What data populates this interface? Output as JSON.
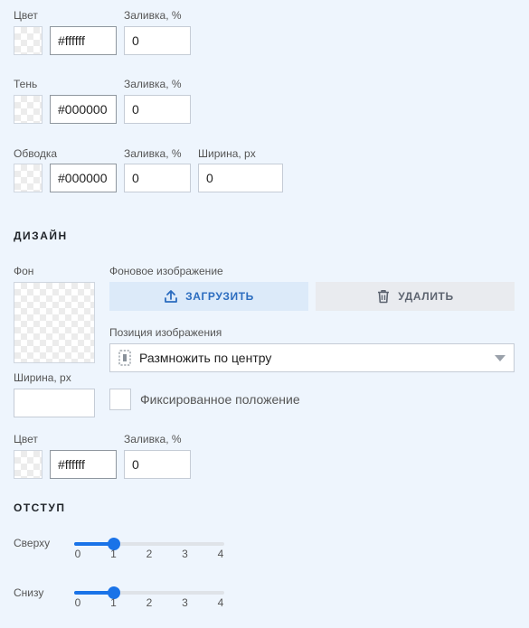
{
  "color_block": {
    "label": "Цвет",
    "fill_label": "Заливка, %",
    "hex": "#ffffff",
    "fill": "0"
  },
  "shadow_block": {
    "label": "Тень",
    "fill_label": "Заливка, %",
    "hex": "#000000",
    "fill": "0"
  },
  "stroke_block": {
    "label": "Обводка",
    "fill_label": "Заливка, %",
    "width_label": "Ширина, px",
    "hex": "#000000",
    "fill": "0",
    "width": "0"
  },
  "design": {
    "title": "ДИЗАЙН",
    "bg_label": "Фон",
    "bg_image_label": "Фоновое изображение",
    "upload_label": "ЗАГРУЗИТЬ",
    "delete_label": "УДАЛИТЬ",
    "position_label": "Позиция изображения",
    "position_value": "Размножить по центру",
    "width_label": "Ширина, px",
    "width_value": "",
    "fixed_label": "Фиксированное положение",
    "fixed_checked": false,
    "color_label": "Цвет",
    "fill_label": "Заливка, %",
    "hex": "#ffffff",
    "fill": "0"
  },
  "padding": {
    "title": "ОТСТУП",
    "top_label": "Сверху",
    "bottom_label": "Снизу",
    "ticks": [
      "0",
      "1",
      "2",
      "3",
      "4"
    ],
    "top_value": 1,
    "bottom_value": 1,
    "max": 4
  },
  "colors": {
    "accent": "#1a73e8",
    "upload_bg": "#dceaf9",
    "delete_bg": "#e9ebef",
    "page_bg": "#eef5fd"
  },
  "icons": {
    "upload": "upload-icon",
    "delete": "trash-icon",
    "position": "tile-center-icon",
    "dropdown": "chevron-down-icon"
  }
}
